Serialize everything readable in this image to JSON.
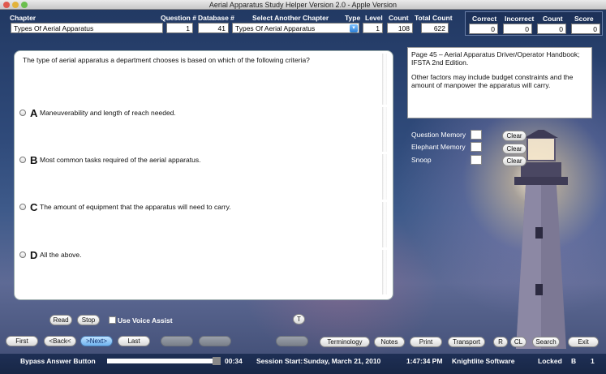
{
  "window": {
    "title": "Aerial Apparatus Study Helper Version 2.0 - Apple Version"
  },
  "header": {
    "chapter_label": "Chapter",
    "chapter_value": "Types Of Aerial Apparatus",
    "question_num_label": "Question #",
    "question_num_value": "1",
    "database_num_label": "Database #",
    "database_num_value": "41",
    "select_chapter_label": "Select Another Chapter",
    "select_chapter_value": "Types Of Aerial Apparatus",
    "type_label": "Type",
    "level_label": "Level",
    "level_value": "1",
    "count_label": "Count",
    "count_value": "108",
    "total_count_label": "Total Count",
    "total_count_value": "622"
  },
  "score": {
    "correct_label": "Correct",
    "correct_value": "0",
    "incorrect_label": "Incorrect",
    "incorrect_value": "0",
    "count_label": "Count",
    "count_value": "0",
    "score_label": "Score",
    "score_value": "0"
  },
  "question": {
    "text": "The type of aerial apparatus a department chooses is based on which of the following criteria?",
    "answers": [
      {
        "letter": "A",
        "text": "Maneuverability and length of reach needed."
      },
      {
        "letter": "B",
        "text": "Most common tasks required of the aerial apparatus."
      },
      {
        "letter": "C",
        "text": "The amount of equipment that the apparatus will need to carry."
      },
      {
        "letter": "D",
        "text": "All the above."
      }
    ]
  },
  "reference": {
    "line1": "Page 45 – Aerial Apparatus Driver/Operator Handbook; IFSTA 2nd Edition.",
    "line2": "Other factors may include budget constraints and the amount of manpower the apparatus will carry."
  },
  "memory": {
    "question_memory_label": "Question Memory",
    "elephant_memory_label": "Elephant Memory",
    "snoop_label": "Snoop",
    "clear_label": "Clear"
  },
  "controls": {
    "read_label": "Read",
    "stop_label": "Stop",
    "voice_assist_label": "Use Voice Assist",
    "t_label": "T"
  },
  "nav": {
    "first_label": "First",
    "back_label": "<Back<",
    "next_label": ">Next>",
    "last_label": "Last",
    "terminology_label": "Terminology",
    "notes_label": "Notes",
    "print_label": "Print",
    "transport_label": "Transport",
    "r_label": "R",
    "cl_label": "CL",
    "search_label": "Search",
    "exit_label": "Exit"
  },
  "status": {
    "bypass_label": "Bypass Answer Button",
    "progress_fraction": 0.93,
    "timer": "00:34",
    "session_label": "Session Start:",
    "session_date": "Sunday, March 21, 2010",
    "time": "1:47:34 PM",
    "company": "Knightlite Software",
    "locked_label": "Locked",
    "b_label": "B",
    "page_num": "1"
  },
  "colors": {
    "accent_blue": "#6fb4f0",
    "panel_bg": "#ffffff",
    "scene_dark": "#223963"
  }
}
